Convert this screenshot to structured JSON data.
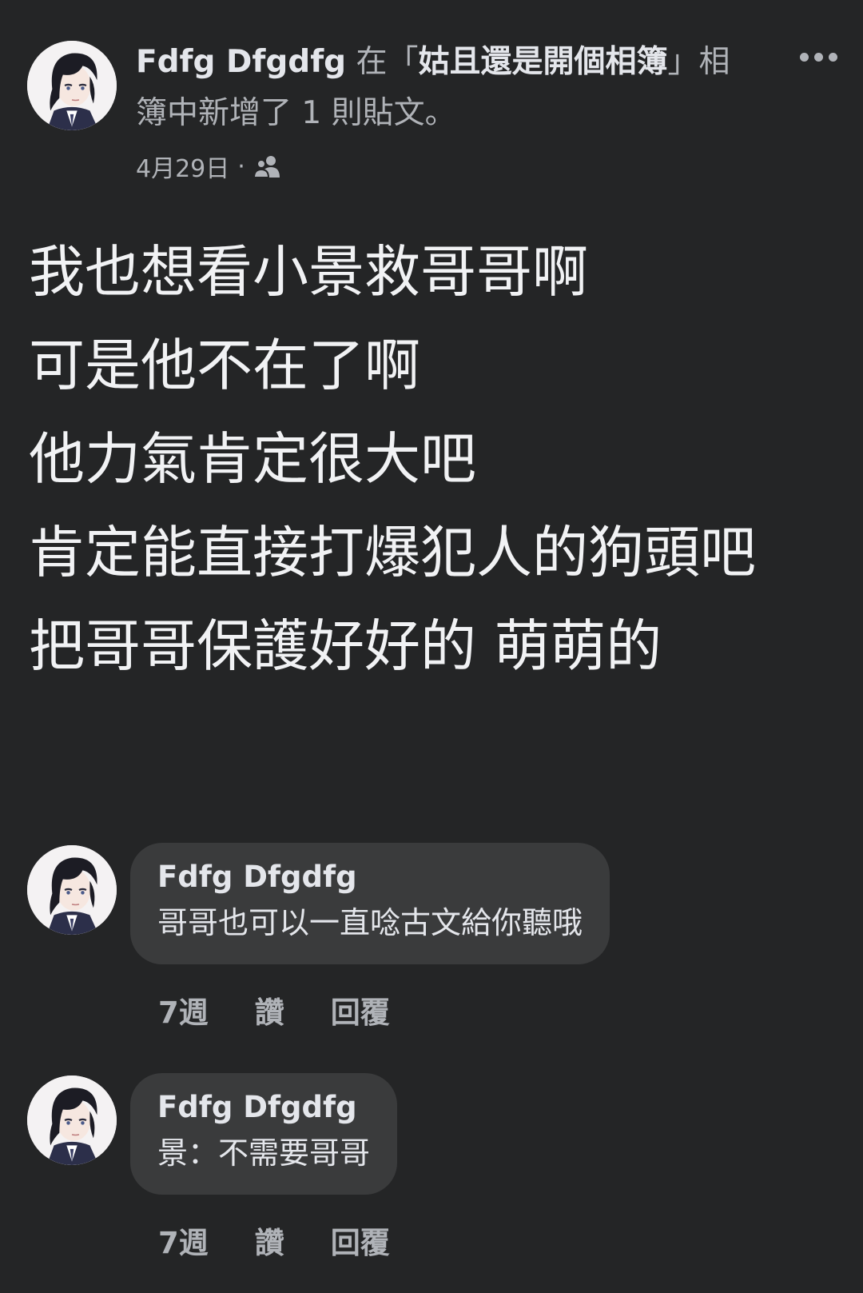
{
  "post": {
    "author": "Fdfg Dfgdfg",
    "action_prefix": " 在「",
    "album": "姑且還是開個相簿",
    "action_suffix": "」相簿中新增了 1 則貼文。",
    "date": "4月29日",
    "separator": "·",
    "privacy_icon": "friends-icon",
    "body_lines": [
      "我也想看小景救哥哥啊",
      "可是他不在了啊",
      "他力氣肯定很大吧",
      "肯定能直接打爆犯人的狗頭吧",
      "把哥哥保護好好的 萌萌的"
    ]
  },
  "comments": [
    {
      "author": "Fdfg Dfgdfg",
      "text": "哥哥也可以一直唸古文給你聽哦",
      "time": "7週",
      "like_label": "讚",
      "reply_label": "回覆"
    },
    {
      "author": "Fdfg Dfgdfg",
      "text": "景：不需要哥哥",
      "time": "7週",
      "like_label": "讚",
      "reply_label": "回覆"
    }
  ],
  "colors": {
    "background": "#242526",
    "bubble": "#3a3b3c",
    "primary_text": "#e4e6eb",
    "secondary_text": "#b0b3b8"
  }
}
